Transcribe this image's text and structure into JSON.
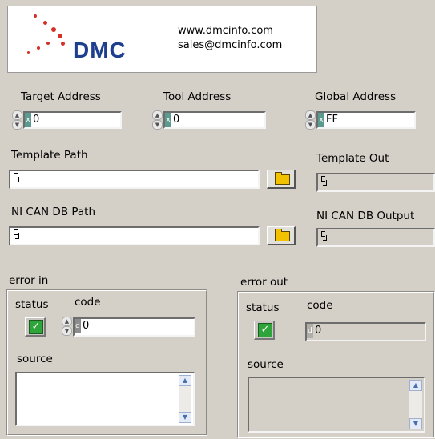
{
  "logo": {
    "brand": "DMC",
    "website": "www.dmcinfo.com",
    "email": "sales@dmcinfo.com"
  },
  "controls": {
    "target_address": {
      "label": "Target Address",
      "radix": "x",
      "value": "0"
    },
    "tool_address": {
      "label": "Tool Address",
      "radix": "x",
      "value": "0"
    },
    "global_address": {
      "label": "Global Address",
      "radix": "x",
      "value": "FF"
    },
    "template_path": {
      "label": "Template Path",
      "value": ""
    },
    "template_out": {
      "label": "Template Out",
      "value": ""
    },
    "can_db_path": {
      "label": "NI CAN DB Path",
      "value": ""
    },
    "can_db_output": {
      "label": "NI CAN DB Output",
      "value": ""
    }
  },
  "error_in": {
    "title": "error in",
    "status_label": "status",
    "code_label": "code",
    "code_radix": "d",
    "code_value": "0",
    "source_label": "source",
    "source_value": ""
  },
  "error_out": {
    "title": "error out",
    "status_label": "status",
    "code_label": "code",
    "code_radix": "d",
    "code_value": "0",
    "source_label": "source",
    "source_value": ""
  },
  "icons": {
    "status_ok": "check-icon",
    "browse": "folder-icon",
    "scroll_up": "arrow-up-icon",
    "scroll_down": "arrow-down-icon",
    "increment": "spin-up-icon",
    "decrement": "spin-down-icon"
  },
  "colors": {
    "brand_blue": "#1e3e8e",
    "brand_red": "#d43026",
    "status_ok": "#2ea53a",
    "panel_bg": "#d4d0c8"
  }
}
